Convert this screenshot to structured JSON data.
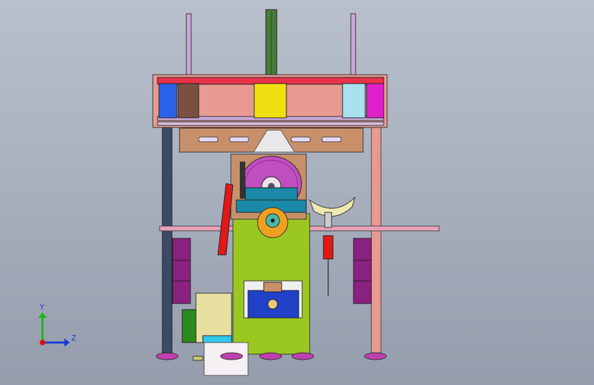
{
  "viewport": {
    "background_top": "#b9c0cc",
    "background_bottom": "#959dac"
  },
  "triad": {
    "y_label": "Y",
    "z_label": "Z",
    "y_color": "#18b818",
    "z_color": "#1b3bd8",
    "x_color": "#e01010"
  },
  "model_colors": {
    "frame_red": "#e8334a",
    "frame_pink": "#e89a92",
    "column_lavender": "#c8a8d8",
    "column_green": "#4a7a3a",
    "block_blue": "#2a62e8",
    "block_brown": "#7a5040",
    "block_yellow": "#f0e010",
    "block_lightblue": "#a8e0f0",
    "block_magenta": "#e020c8",
    "plate_orange": "#c8906a",
    "body_green": "#9ac820",
    "wheel_purple": "#c050c0",
    "roller_orange": "#f0a020",
    "blue_box": "#2040c8",
    "feet_purple": "#c040b0",
    "magazine_purple": "#8a2080",
    "teal": "#1a8aa8",
    "pink_rail": "#e8a0b8"
  }
}
